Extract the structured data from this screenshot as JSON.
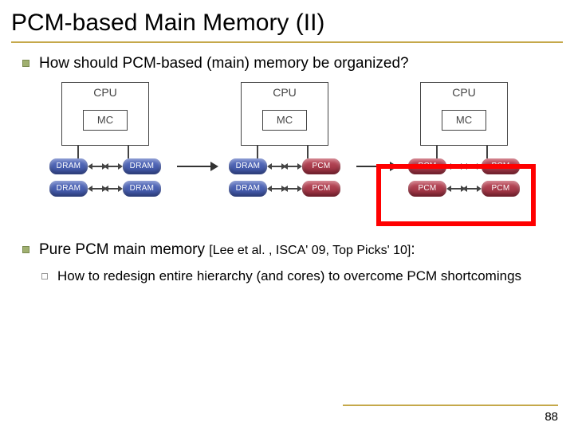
{
  "title": "PCM-based Main Memory (II)",
  "bullets": {
    "q": "How should PCM-based (main) memory be organized?",
    "pure": "Pure PCM main memory ",
    "cite": "[Lee et al. , ISCA' 09, Top Picks' 10]",
    "colon": ":",
    "sub": "How to redesign entire hierarchy (and cores) to overcome PCM shortcomings"
  },
  "labels": {
    "cpu": "CPU",
    "mc": "MC",
    "dram": "DRAM",
    "pcm": "PCM"
  },
  "pagenum": "88"
}
